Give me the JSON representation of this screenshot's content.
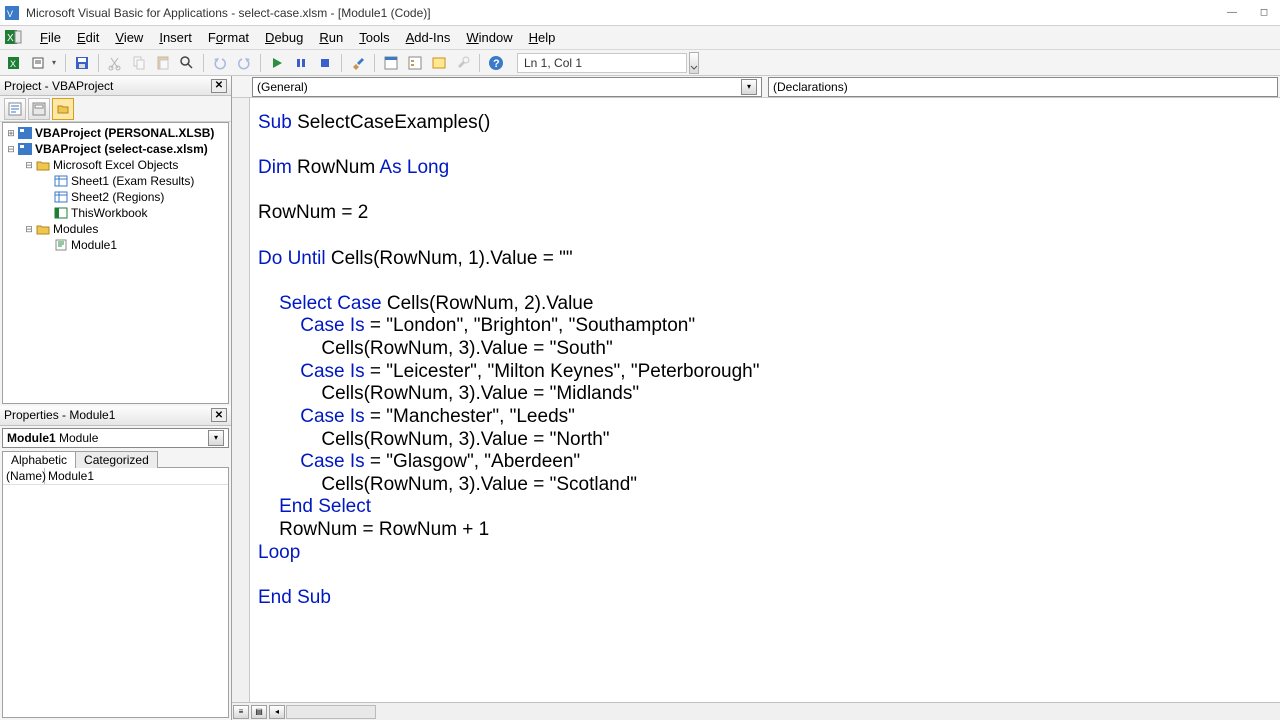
{
  "window": {
    "title": "Microsoft Visual Basic for Applications - select-case.xlsm - [Module1 (Code)]"
  },
  "menu": {
    "file": "File",
    "edit": "Edit",
    "view": "View",
    "insert": "Insert",
    "format": "Format",
    "debug": "Debug",
    "run": "Run",
    "tools": "Tools",
    "addins": "Add-Ins",
    "window": "Window",
    "help": "Help"
  },
  "toolbar": {
    "cursor_position": "Ln 1, Col 1"
  },
  "code_dropdowns": {
    "left": "(General)",
    "right": "(Declarations)"
  },
  "project_panel": {
    "title": "Project - VBAProject",
    "nodes": {
      "personal": "VBAProject (PERSONAL.XLSB)",
      "selectcase": "VBAProject (select-case.xlsm)",
      "excel_objects": "Microsoft Excel Objects",
      "sheet1": "Sheet1 (Exam Results)",
      "sheet2": "Sheet2 (Regions)",
      "thiswb": "ThisWorkbook",
      "modules": "Modules",
      "module1": "Module1"
    }
  },
  "properties_panel": {
    "title": "Properties - Module1",
    "object_bold": "Module1",
    "object_type": "Module",
    "tab_alpha": "Alphabetic",
    "tab_cat": "Categorized",
    "row_name_key": "(Name)",
    "row_name_val": "Module1"
  },
  "code": {
    "l1a": "Sub",
    "l1b": " SelectCaseExamples()",
    "l2a": "Dim",
    "l2b": " RowNum ",
    "l2c": "As Long",
    "l3": "RowNum = 2",
    "l4a": "Do Until",
    "l4b": " Cells(RowNum, 1).Value = \"\"",
    "l5a": "    Select Case",
    "l5b": " Cells(RowNum, 2).Value",
    "l6a": "        Case Is",
    "l6b": " = \"London\", \"Brighton\", \"Southampton\"",
    "l7": "            Cells(RowNum, 3).Value = \"South\"",
    "l8a": "        Case Is",
    "l8b": " = \"Leicester\", \"Milton Keynes\", \"Peterborough\"",
    "l9": "            Cells(RowNum, 3).Value = \"Midlands\"",
    "l10a": "        Case Is",
    "l10b": " = \"Manchester\", \"Leeds\"",
    "l11": "            Cells(RowNum, 3).Value = \"North\"",
    "l12a": "        Case Is",
    "l12b": " = \"Glasgow\", \"Aberdeen\"",
    "l13": "            Cells(RowNum, 3).Value = \"Scotland\"",
    "l14": "    End Select",
    "l15": "    RowNum = RowNum + 1",
    "l16": "Loop",
    "l17": "End Sub"
  }
}
